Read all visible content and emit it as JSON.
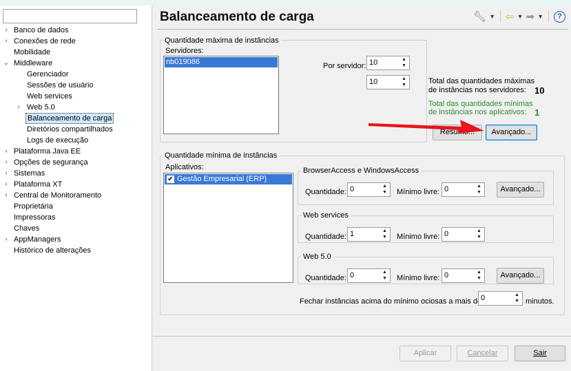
{
  "sidebar": {
    "search_placeholder": "",
    "items": [
      {
        "label": "Banco de dados",
        "exp": "›"
      },
      {
        "label": "Conexões de rede",
        "exp": "›"
      },
      {
        "label": "Mobilidade",
        "exp": ""
      },
      {
        "label": "Middleware",
        "exp": "⌄"
      },
      {
        "label": "Gerenciador",
        "exp": ""
      },
      {
        "label": "Sessões de usuário",
        "exp": ""
      },
      {
        "label": "Web services",
        "exp": ""
      },
      {
        "label": "Web 5.0",
        "exp": "›"
      },
      {
        "label": "Balanceamento de carga",
        "exp": ""
      },
      {
        "label": "Diretórios compartilhados",
        "exp": ""
      },
      {
        "label": "Logs de execução",
        "exp": ""
      },
      {
        "label": "Plataforma Java EE",
        "exp": "›"
      },
      {
        "label": "Opções de segurança",
        "exp": "›"
      },
      {
        "label": "Sistemas",
        "exp": "›"
      },
      {
        "label": "Plataforma XT",
        "exp": "›"
      },
      {
        "label": "Central de Monitoramento",
        "exp": "›"
      },
      {
        "label": "Proprietária",
        "exp": ""
      },
      {
        "label": "Impressoras",
        "exp": ""
      },
      {
        "label": "Chaves",
        "exp": ""
      },
      {
        "label": "AppManagers",
        "exp": "›"
      },
      {
        "label": "Histórico de alterações",
        "exp": ""
      }
    ]
  },
  "header": {
    "title": "Balanceamento de carga",
    "icons": [
      "wrench-icon",
      "back-arrow-icon",
      "forward-arrow-icon",
      "help-icon"
    ],
    "help_glyph": "?"
  },
  "max_group": {
    "title": "Quantidade máxima de instâncias",
    "servers_label": "Servidores:",
    "servers": [
      "nb019086"
    ],
    "per_server_label": "Por servidor:",
    "per_server_value": "10",
    "second_value": "10",
    "total_max_line1": "Total das quantidades máximas",
    "total_max_line2": "de instâncias nos servidores:",
    "total_max_value": "10",
    "total_min_line1": "Total das quantidades mínimas",
    "total_min_line2": "de instâncias nos aplicativos:",
    "total_min_value": "1",
    "summary_button": "Resumo...",
    "advanced_button": "Avançado..."
  },
  "min_group": {
    "title": "Quantidade mínima de instâncias",
    "apps_label": "Aplicativos:",
    "apps": [
      {
        "label": "Gestão Empresarial (ERP)",
        "checked": true
      }
    ],
    "check_glyph": "✔",
    "sections": [
      {
        "title": "BrowserAccess e WindowsAccess",
        "qty_label": "Quantidade:",
        "qty": "0",
        "min_label": "Mínimo livre:",
        "min": "0",
        "button": "Avançado..."
      },
      {
        "title": "Web services",
        "qty_label": "Quantidade:",
        "qty": "1",
        "min_label": "Mínimo livre:",
        "min": "0",
        "button": ""
      },
      {
        "title": "Web 5.0",
        "qty_label": "Quantidade:",
        "qty": "0",
        "min_label": "Mínimo livre:",
        "min": "0",
        "button": "Avançado..."
      }
    ],
    "close_label": "Fechar instâncias acima do mínimo ociosas a mais de",
    "close_value": "0",
    "close_unit": "minutos."
  },
  "footer": {
    "apply": "Aplicar",
    "cancel": "Cancelar",
    "exit": "Sair"
  },
  "colors": {
    "selection": "#3a78d8",
    "green_text": "#2e8b2e",
    "arrow": "#e8141b"
  }
}
